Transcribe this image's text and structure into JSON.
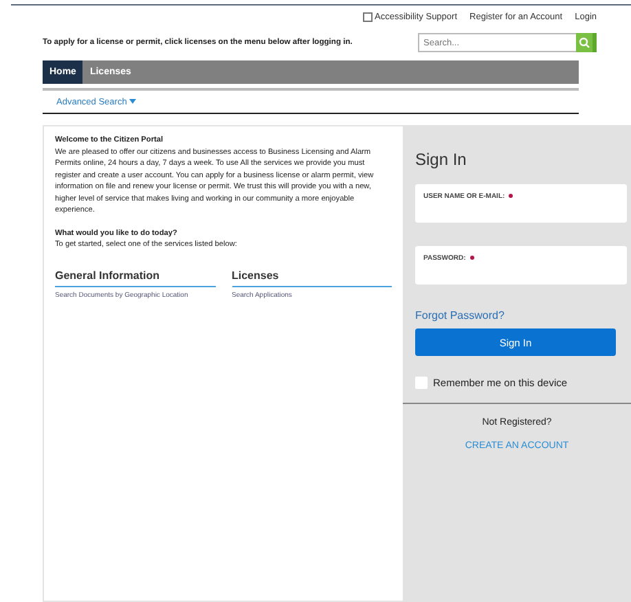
{
  "top_links": {
    "accessibility": {
      "label": "Accessibility Support",
      "checked": false
    },
    "links": [
      "Register for an Account",
      "Login"
    ]
  },
  "intro": "To apply for a license or permit, click licenses on the menu below after logging in.",
  "search": {
    "placeholder": "Search..."
  },
  "tabs": [
    {
      "label": "Home",
      "selected": true
    },
    {
      "label": "Licenses",
      "selected": false
    }
  ],
  "advanced_search": "Advanced Search",
  "welcome": {
    "title": "Welcome to the Citizen Portal",
    "body": "We are pleased to offer our citizens and businesses access to Business Licensing and Alarm Permits online, 24 hours a day, 7 days a week.  To use All the services we provide you must register and create a user account.  You can apply for a business license or alarm permit, view information on file and renew your license or permit.  We trust this will provide you with a new, higher level of service that makes living and working in our community a more enjoyable experience."
  },
  "question": {
    "title": "What would you like to do today?",
    "body": "To get started, select one of the services listed below:"
  },
  "services": [
    {
      "heading": "General Information",
      "links": [
        "Search Documents by Geographic Location"
      ]
    },
    {
      "heading": "Licenses",
      "links": [
        "Search Applications"
      ]
    }
  ],
  "sign_in": {
    "title": "Sign In",
    "fields": [
      {
        "label": "USER NAME OR E-MAIL:",
        "required": true
      },
      {
        "label": "PASSWORD:",
        "required": true
      }
    ],
    "forgot": "Forgot Password?",
    "button": "Sign In",
    "remember": {
      "label": "Remember me on this device",
      "checked": false
    },
    "not_registered": "Not Registered?",
    "create": "CREATE AN ACCOUNT"
  }
}
